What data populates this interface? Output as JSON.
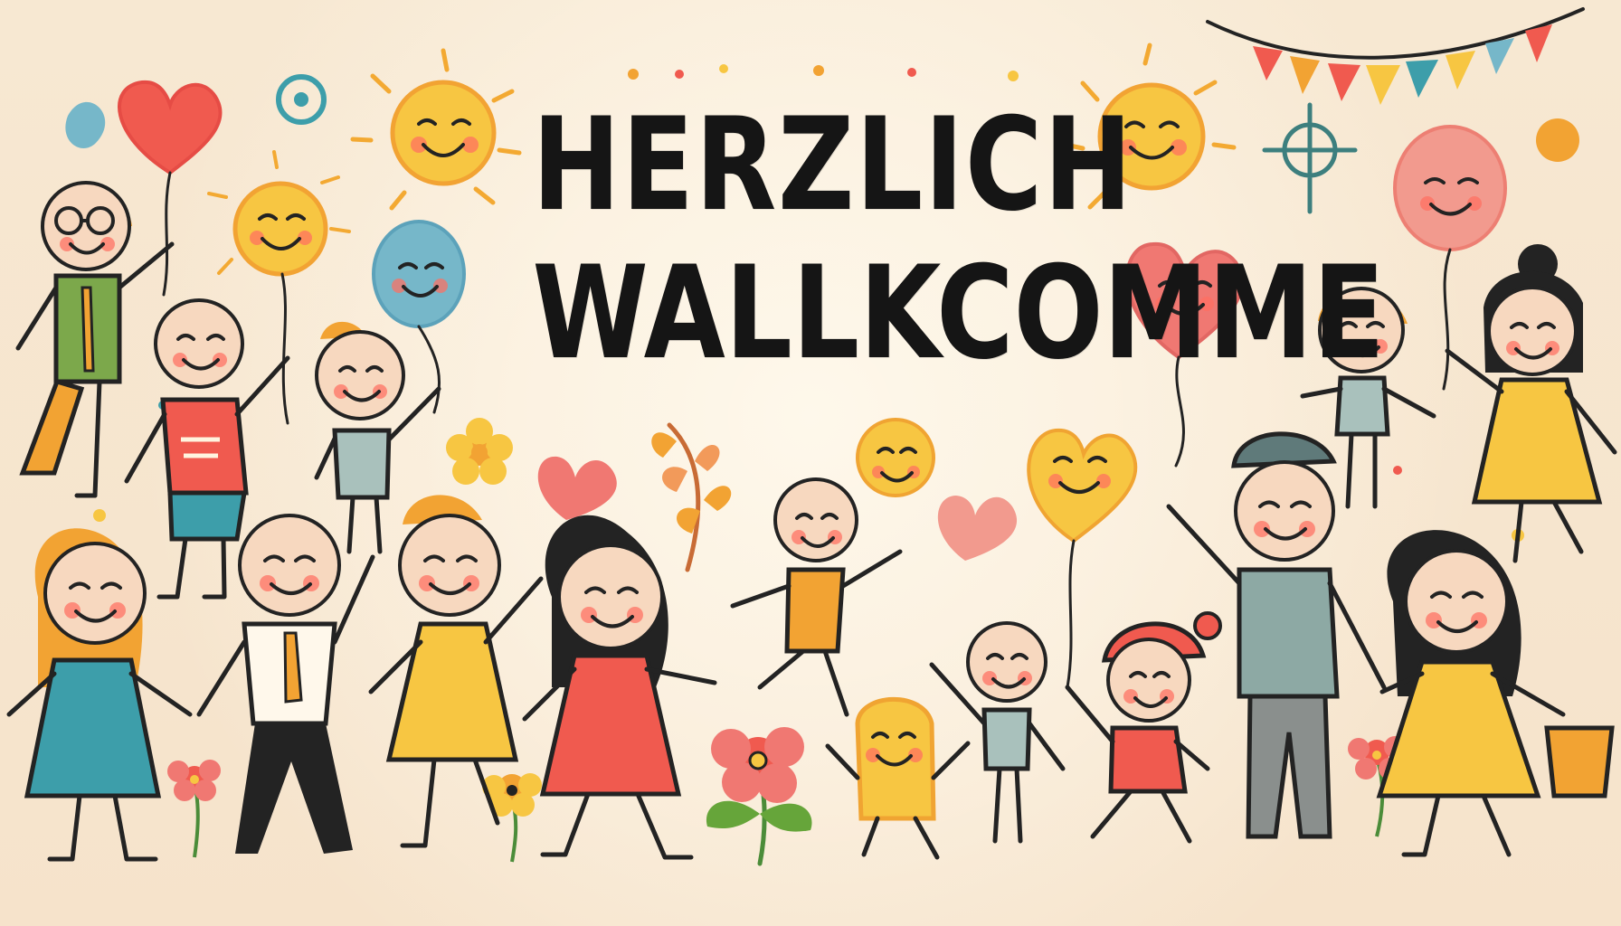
{
  "greeting": {
    "line1": "HERZLICH",
    "line2": "WALLKCOMME"
  },
  "colors": {
    "background": "#f6e5cf",
    "text": "#151515",
    "red": "#f05a4f",
    "orange": "#f2a333",
    "yellow": "#f7c642",
    "teal": "#3d9eaa",
    "green": "#7ca84b",
    "pink": "#f07872",
    "blue": "#76b7c9"
  },
  "decorations": [
    "smiling-sun",
    "heart-balloon",
    "round-balloon",
    "flower",
    "bunting",
    "children-holding-hands"
  ]
}
